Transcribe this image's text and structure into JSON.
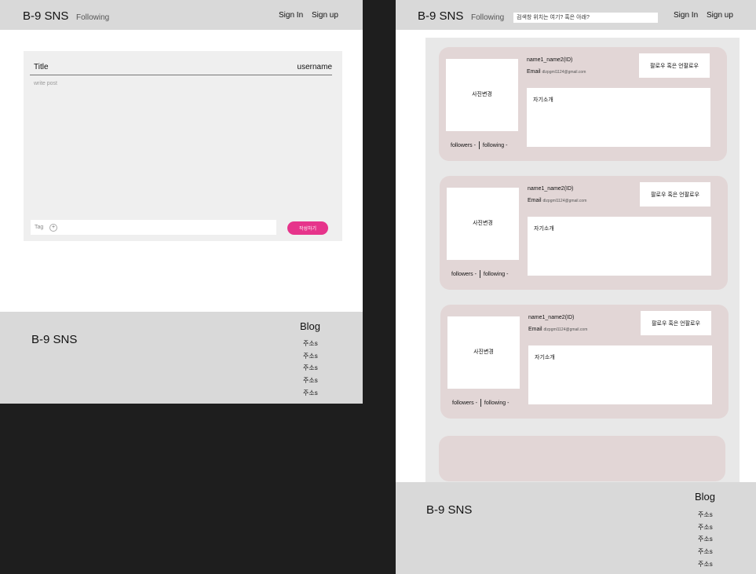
{
  "left": {
    "nav": {
      "brand": "B-9 SNS",
      "following": "Following",
      "sign_in": "Sign In",
      "sign_up": "Sign up"
    },
    "editor": {
      "title": "Title",
      "username": "username",
      "body_placeholder": "write post",
      "tag_label": "Tag",
      "tag_add": "+",
      "submit_label": "작성하기"
    },
    "footer": {
      "brand": "B-9 SNS",
      "blog_title": "Blog",
      "items": [
        "주소s",
        "주소s",
        "주소s",
        "주소s",
        "주소s"
      ]
    }
  },
  "right": {
    "nav": {
      "brand": "B-9 SNS",
      "following": "Following",
      "search_placeholder": "검색창 위치는 여기? 혹은 아래?",
      "sign_in": "Sign In",
      "sign_up": "Sign up"
    },
    "cards": [
      {
        "photo_label": "사진변경",
        "name": "name1_name2(ID)",
        "email_label": "Email",
        "email": "dlzpgml1124@gmail.com",
        "follow_label": "팔로우 혹은 언팔로우",
        "bio": "자기소개",
        "followers": "followers -",
        "following": "following -"
      },
      {
        "photo_label": "사진변경",
        "name": "name1_name2(ID)",
        "email_label": "Email",
        "email": "dlzpgml1124@gmail.com",
        "follow_label": "팔로우 혹은 언팔로우",
        "bio": "자기소개",
        "followers": "followers -",
        "following": "following -"
      },
      {
        "photo_label": "사진변경",
        "name": "name1_name2(ID)",
        "email_label": "Email",
        "email": "dlzpgml1124@gmail.com",
        "follow_label": "팔로우 혹은 언팔로우",
        "bio": "자기소개",
        "followers": "followers -",
        "following": "following -"
      }
    ],
    "footer": {
      "brand": "B-9 SNS",
      "blog_title": "Blog",
      "items": [
        "주소s",
        "주소s",
        "주소s",
        "주소s",
        "주소s"
      ]
    }
  },
  "colors": {
    "accent": "#e6348b",
    "nav_bg": "#d9d9d9",
    "card_bg": "#e2d6d6",
    "feed_bg": "#e8e8e8",
    "canvas_bg": "#1e1e1e"
  }
}
